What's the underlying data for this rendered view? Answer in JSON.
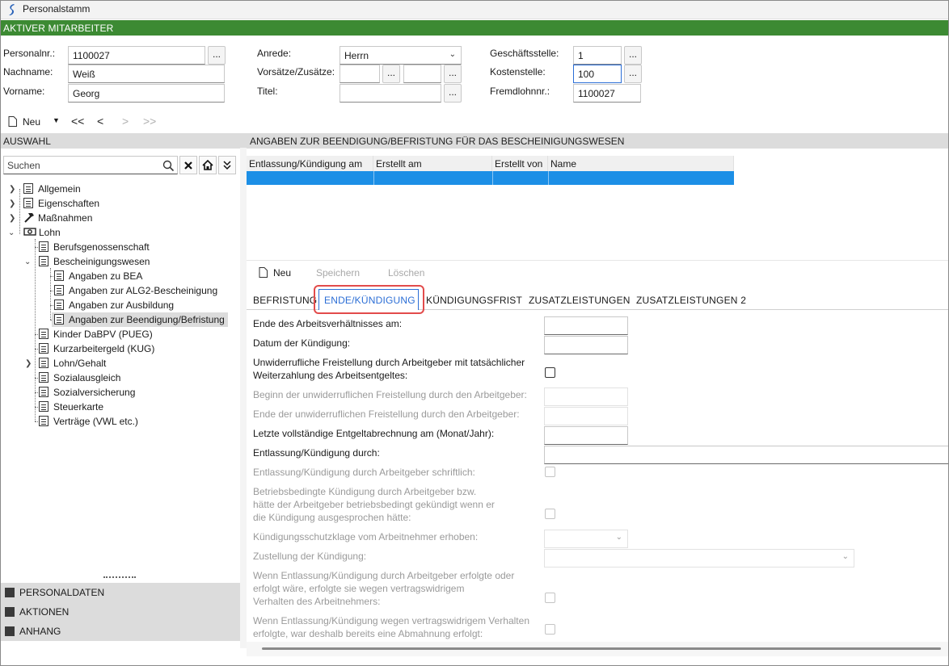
{
  "window": {
    "title": "Personalstamm"
  },
  "active_section": "AKTIVER MITARBEITER",
  "header": {
    "personalnr_label": "Personalnr.:",
    "personalnr_value": "1100027",
    "nachname_label": "Nachname:",
    "nachname_value": "Weiß",
    "vorname_label": "Vorname:",
    "vorname_value": "Georg",
    "anrede_label": "Anrede:",
    "anrede_value": "Herrn",
    "vorsaetze_label": "Vorsätze/Zusätze:",
    "titel_label": "Titel:",
    "geschaeftsstelle_label": "Geschäftsstelle:",
    "geschaeftsstelle_value": "1",
    "kostenstelle_label": "Kostenstelle:",
    "kostenstelle_value": "100",
    "fremdlohnnr_label": "Fremdlohnnr.:",
    "fremdlohnnr_value": "1100027",
    "ellipsis": "..."
  },
  "toolbar": {
    "new_label": "Neu",
    "first": "<<",
    "prev": "<",
    "next": ">",
    "last": ">>"
  },
  "left": {
    "section_title": "AUSWAHL",
    "search_placeholder": "Suchen",
    "tree": [
      {
        "label": "Allgemein"
      },
      {
        "label": "Eigenschaften"
      },
      {
        "label": "Maßnahmen"
      },
      {
        "label": "Lohn"
      },
      {
        "label": "Berufsgenossenschaft"
      },
      {
        "label": "Bescheinigungswesen"
      },
      {
        "label": "Angaben zu BEA"
      },
      {
        "label": "Angaben zur ALG2-Bescheinigung"
      },
      {
        "label": "Angaben zur Ausbildung"
      },
      {
        "label": "Angaben zur Beendigung/Befristung"
      },
      {
        "label": "Kinder DaBPV (PUEG)"
      },
      {
        "label": "Kurzarbeitergeld (KUG)"
      },
      {
        "label": "Lohn/Gehalt"
      },
      {
        "label": "Sozialausgleich"
      },
      {
        "label": "Sozialversicherung"
      },
      {
        "label": "Steuerkarte"
      },
      {
        "label": "Verträge (VWL etc.)"
      }
    ],
    "bottom_panes": [
      "PERSONALDATEN",
      "AKTIONEN",
      "ANHANG"
    ]
  },
  "main": {
    "section_title": "ANGABEN ZUR BEENDIGUNG/BEFRISTUNG FÜR DAS BESCHEINIGUNGSWESEN",
    "columns": [
      "Entlassung/Kündigung am",
      "Erstellt am",
      "Erstellt von",
      "Name"
    ],
    "actions": {
      "new": "Neu",
      "save": "Speichern",
      "delete": "Löschen"
    },
    "tabs": [
      "BEFRISTUNG",
      "ENDE/KÜNDIGUNG",
      "KÜNDIGUNGSFRIST",
      "ZUSATZLEISTUNGEN",
      "ZUSATZLEISTUNGEN 2"
    ],
    "active_tab": "ENDE/KÜNDIGUNG",
    "fields": {
      "ende_arbeitsverhaeltnis": "Ende des Arbeitsverhältnisses am:",
      "datum_kuendigung": "Datum der Kündigung:",
      "freistellung_line1": "Unwiderrufliche Freistellung durch Arbeitgeber mit tatsächlicher",
      "freistellung_line2": "Weiterzahlung des Arbeitsentgeltes:",
      "beginn_freistellung": "Beginn der unwiderruflichen Freistellung durch den Arbeitgeber:",
      "ende_freistellung": "Ende der unwiderruflichen Freistellung durch den Arbeitgeber:",
      "letzte_abrechnung": "Letzte vollständige Entgeltabrechnung am (Monat/Jahr):",
      "kuendigung_durch": "Entlassung/Kündigung durch:",
      "schriftlich": "Entlassung/Kündigung durch Arbeitgeber schriftlich:",
      "betriebsbedingt_line1": "Betriebsbedingte Kündigung durch Arbeitgeber bzw.",
      "betriebsbedingt_line2": "hätte der Arbeitgeber betriebsbedingt gekündigt wenn er",
      "betriebsbedingt_line3": "die Kündigung ausgesprochen hätte:",
      "schutzklage": "Kündigungsschutzklage vom Arbeitnehmer erhoben:",
      "zustellung": "Zustellung der Kündigung:",
      "vertragswidrig_line1": "Wenn Entlassung/Kündigung durch Arbeitgeber erfolgte oder",
      "vertragswidrig_line2": "erfolgt wäre, erfolgte sie wegen vertragswidrigem",
      "vertragswidrig_line3": "Verhalten des Arbeitnehmers:",
      "abmahnung_line1": "Wenn Entlassung/Kündigung wegen vertragswidrigem Verhalten",
      "abmahnung_line2": "erfolgte, war deshalb bereits eine Abmahnung erfolgt:"
    }
  },
  "colors": {
    "header_green": "#3c8a33",
    "selection_blue": "#1c8fe6",
    "highlight_red": "#e24b4b"
  }
}
